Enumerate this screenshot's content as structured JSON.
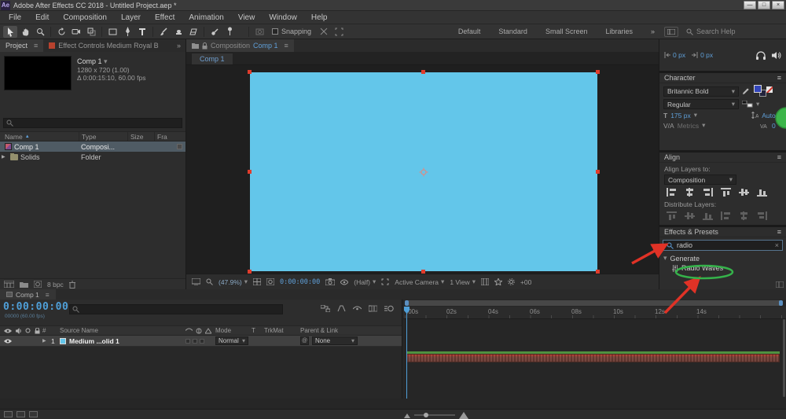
{
  "icons": {
    "menu": "≡",
    "chevron_down": "▾",
    "twirl_closed": "▶",
    "triangle_up": "▲",
    "double_chevron": "»",
    "close": "×",
    "minimize": "—",
    "maximize": "□",
    "pickwhip": "@"
  },
  "title_bar": {
    "app_badge": "Ae",
    "title": "Adobe After Effects CC 2018 - Untitled Project.aep *"
  },
  "menu_bar": {
    "items": [
      "File",
      "Edit",
      "Composition",
      "Layer",
      "Effect",
      "Animation",
      "View",
      "Window",
      "Help"
    ]
  },
  "toolbar": {
    "snapping_label": "Snapping",
    "workspaces": [
      "Default",
      "Standard",
      "Small Screen",
      "Libraries"
    ],
    "search_placeholder": "Search Help"
  },
  "project_panel": {
    "tab_project": "Project",
    "tab_effect_controls": "Effect Controls Medium Royal B",
    "comp_name": "Comp 1",
    "comp_info_size": "1280 x 720 (1.00)",
    "comp_info_time": "Δ 0:00:15:10, 60.00 fps",
    "columns": {
      "name": "Name",
      "type": "Type",
      "size": "Size",
      "frames": "Fra"
    },
    "rows": [
      {
        "name": "Comp 1",
        "type": "Composi..."
      },
      {
        "name": "Solids",
        "type": "Folder"
      }
    ],
    "bpc_label": "8 bpc"
  },
  "composition_panel": {
    "tab_prefix": "Composition",
    "tab_comp": "Comp 1",
    "viewer_tab": "Comp 1",
    "zoom_value": "(47.9%)",
    "timecode": "0:00:00:00",
    "resolution": "(Half)",
    "camera_view": "Active Camera",
    "view_count": "1 View",
    "exposure": "+00"
  },
  "properties_strip": {
    "x_value": "0 px",
    "y_value": "0 px"
  },
  "character_panel": {
    "title": "Character",
    "font_name": "Britannic Bold",
    "font_style": "Regular",
    "size_label": "T",
    "size_value": "175 px",
    "leading_value": "Auto",
    "kerning_label": "V/A",
    "kerning_value": "Metrics",
    "tracking_value": "0"
  },
  "align_panel": {
    "title": "Align",
    "align_layers_label": "Align Layers to:",
    "align_target": "Composition",
    "distribute_label": "Distribute Layers:"
  },
  "effects_panel": {
    "title": "Effects & Presets",
    "search_value": "radio",
    "group_label": "Generate",
    "result_label": "Radio Waves"
  },
  "timeline": {
    "tab_label": "Comp 1",
    "timecode": "0:00:00:00",
    "frame_info": "00000 (60.00 fps)",
    "columns": {
      "layer_number": "#",
      "source_name": "Source Name",
      "mode": "Mode",
      "t": "T",
      "trkmat": "TrkMat",
      "parent": "Parent & Link"
    },
    "layer": {
      "number": "1",
      "name": "Medium ...olid 1",
      "mode": "Normal",
      "parent": "None"
    },
    "ruler_ticks": [
      ":00s",
      "02s",
      "04s",
      "06s",
      "08s",
      "10s",
      "12s",
      "14s"
    ]
  }
}
